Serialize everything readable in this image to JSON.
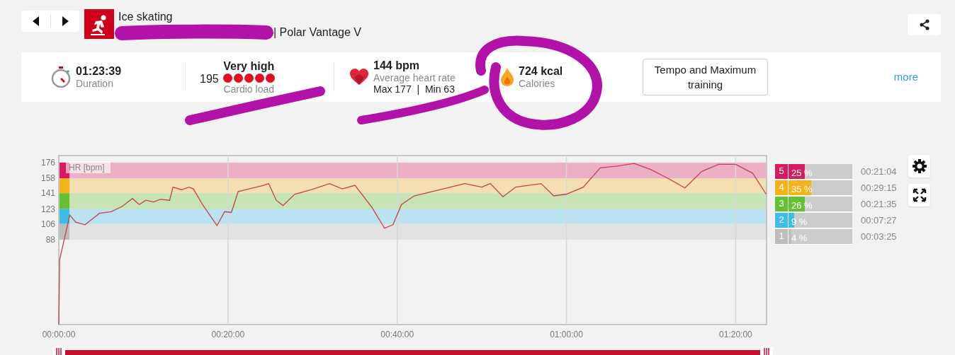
{
  "activity": {
    "sport": "Ice skating",
    "device": "| Polar Vantage V"
  },
  "summary": [
    {
      "kind": "duration",
      "value": "01:23:39",
      "label": "Duration"
    },
    {
      "kind": "cardio",
      "number": "195",
      "value": "Very high",
      "stars": 5,
      "label": "Cardio load"
    },
    {
      "kind": "heart",
      "value": "144 bpm",
      "label": "Average heart rate",
      "detail": "Max 177  |  Min 63"
    },
    {
      "kind": "calories",
      "value": "724 kcal",
      "label": "Calories"
    }
  ],
  "benefit_button": "Tempo and Maximum training",
  "more_link": "more",
  "chart": {
    "chart_data": {
      "type": "line",
      "ylabel": "HR [bpm]",
      "x": [
        0,
        0.1,
        1.3,
        2,
        3.1,
        4,
        4.8,
        6.2,
        7.5,
        8.7,
        9.5,
        10.3,
        11.2,
        12,
        13.1,
        13.5,
        14.5,
        15.4,
        15.9,
        17,
        18.7,
        19.6,
        20.4,
        21.2,
        22.5,
        24.2,
        24.8,
        25.7,
        26.5,
        27.9,
        29.8,
        32,
        33.5,
        35,
        37,
        38.5,
        39.5,
        40.5,
        42,
        45,
        48,
        50,
        51,
        52.5,
        54,
        57,
        58.5,
        60,
        62,
        64,
        66,
        68,
        70,
        72,
        74,
        76,
        78,
        80,
        82,
        83.6
      ],
      "series": [
        {
          "color": "#c8404f",
          "values": [
            -9,
            65,
            116,
            108,
            105,
            112,
            118,
            120,
            126,
            135,
            128,
            133,
            131,
            134,
            133,
            148,
            145,
            148,
            146,
            128,
            104,
            120,
            119,
            143,
            146,
            150,
            152,
            133,
            127,
            140,
            145,
            152,
            146,
            150,
            125,
            101,
            105,
            128,
            138,
            145,
            152,
            148,
            152,
            137,
            148,
            152,
            138,
            140,
            148,
            170,
            172,
            175,
            168,
            158,
            147,
            166,
            174,
            174,
            164,
            140
          ]
        }
      ],
      "xlim": [
        0,
        83.65
      ],
      "ylim": [
        -9,
        184
      ],
      "xticks": [
        {
          "value": 0,
          "label": "00:00:00"
        },
        {
          "value": 20,
          "label": "00:20:00"
        },
        {
          "value": 40,
          "label": "00:40:00"
        },
        {
          "value": 60,
          "label": "01:00:00"
        },
        {
          "value": 80,
          "label": "01:20:00"
        }
      ],
      "yticks": [
        88,
        106,
        123,
        141,
        158,
        176
      ],
      "grid": true,
      "bands": [
        {
          "axis": "y",
          "from": 158,
          "to": 176,
          "color": "#d81b60"
        },
        {
          "axis": "y",
          "from": 141,
          "to": 158,
          "color": "#f5b31a"
        },
        {
          "axis": "y",
          "from": 123,
          "to": 141,
          "color": "#63c132"
        },
        {
          "axis": "y",
          "from": 106,
          "to": 123,
          "color": "#3dbde8"
        },
        {
          "axis": "y",
          "from": 88,
          "to": 106,
          "color": "#bdbdbd"
        }
      ]
    }
  },
  "zones": [
    {
      "number": "5",
      "percent": "25 %",
      "time": "00:21:04",
      "level": 0.25,
      "color": "#d81b60"
    },
    {
      "number": "4",
      "percent": "35 %",
      "time": "00:29:15",
      "level": 0.35,
      "color": "#f5b31a"
    },
    {
      "number": "3",
      "percent": "26 %",
      "time": "00:21:35",
      "level": 0.26,
      "color": "#63c132"
    },
    {
      "number": "2",
      "percent": "9 %",
      "time": "00:07:27",
      "level": 0.09,
      "color": "#3dbde8"
    },
    {
      "number": "1",
      "percent": "4 %",
      "time": "00:03:25",
      "level": 0.04,
      "color": "#bdbdbd"
    }
  ]
}
